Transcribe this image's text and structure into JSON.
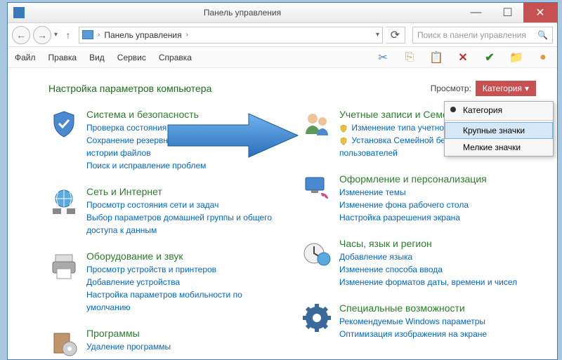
{
  "window": {
    "title": "Панель управления"
  },
  "nav": {
    "breadcrumb": "Панель управления",
    "chevron": "›",
    "search_placeholder": "Поиск в панели управления"
  },
  "menu": {
    "file": "Файл",
    "edit": "Правка",
    "view": "Вид",
    "service": "Сервис",
    "help": "Справка"
  },
  "cp": {
    "heading": "Настройка параметров компьютера",
    "view_label": "Просмотр:",
    "view_value": "Категория"
  },
  "dropdown": {
    "opt1": "Категория",
    "opt2": "Крупные значки",
    "opt3": "Мелкие значки"
  },
  "left": [
    {
      "title": "Система и безопасность",
      "links": [
        "Проверка состояния компьютера",
        "Сохранение резервных копий файлов с помощью истории файлов",
        "Поиск и исправление проблем"
      ],
      "shield": [
        false,
        false,
        false
      ]
    },
    {
      "title": "Сеть и Интернет",
      "links": [
        "Просмотр состояния сети и задач",
        "Выбор параметров домашней группы и общего доступа к данным"
      ]
    },
    {
      "title": "Оборудование и звук",
      "links": [
        "Просмотр устройств и принтеров",
        "Добавление устройства",
        "Настройка параметров мобильности по умолчанию"
      ]
    },
    {
      "title": "Программы",
      "links": [
        "Удаление программы"
      ]
    }
  ],
  "right": [
    {
      "title": "Учетные записи и Семейная безопасность",
      "links": [
        "Изменение типа учетной записи",
        "Установка Семейной безопасности для всех пользователей"
      ],
      "shield": [
        true,
        true
      ]
    },
    {
      "title": "Оформление и персонализация",
      "links": [
        "Изменение темы",
        "Изменение фона рабочего стола",
        "Настройка разрешения экрана"
      ]
    },
    {
      "title": "Часы, язык и регион",
      "links": [
        "Добавление языка",
        "Изменение способа ввода",
        "Изменение форматов даты, времени и чисел"
      ]
    },
    {
      "title": "Специальные возможности",
      "links": [
        "Рекомендуемые Windows параметры",
        "Оптимизация изображения на экране"
      ]
    }
  ],
  "icons": {
    "left": [
      "shield-check",
      "globe-network",
      "printer",
      "box-disc"
    ],
    "right": [
      "user-family",
      "display-paint",
      "clock-globe",
      "gear-ease"
    ]
  }
}
